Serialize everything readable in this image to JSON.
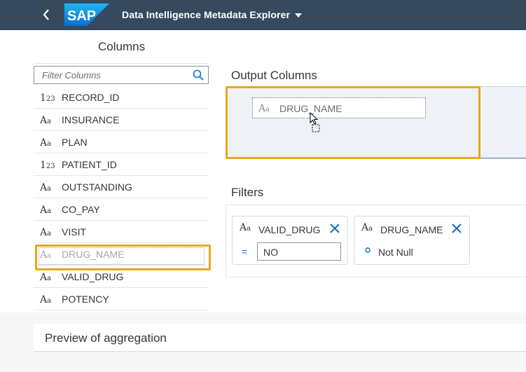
{
  "shell": {
    "app_title": "Data Intelligence Metadata Explorer",
    "logo_text": "SAP",
    "bg_color": "#354a5f"
  },
  "columns_panel": {
    "title": "Columns",
    "filter_placeholder": "Filter Columns",
    "items": [
      {
        "type": "integer",
        "type_glyph_big": "1",
        "type_glyph_small": "23",
        "name": "RECORD_ID"
      },
      {
        "type": "string",
        "type_glyph_big": "A",
        "type_glyph_small": "a",
        "name": "INSURANCE"
      },
      {
        "type": "string",
        "type_glyph_big": "A",
        "type_glyph_small": "a",
        "name": "PLAN"
      },
      {
        "type": "integer",
        "type_glyph_big": "1",
        "type_glyph_small": "23",
        "name": "PATIENT_ID"
      },
      {
        "type": "string",
        "type_glyph_big": "A",
        "type_glyph_small": "a",
        "name": "OUTSTANDING"
      },
      {
        "type": "string",
        "type_glyph_big": "A",
        "type_glyph_small": "a",
        "name": "CO_PAY"
      },
      {
        "type": "string",
        "type_glyph_big": "A",
        "type_glyph_small": "a",
        "name": "VISIT"
      },
      {
        "type": "string",
        "type_glyph_big": "A",
        "type_glyph_small": "a",
        "name": "DRUG_NAME",
        "dragging": true
      },
      {
        "type": "string",
        "type_glyph_big": "A",
        "type_glyph_small": "a",
        "name": "VALID_DRUG"
      },
      {
        "type": "string",
        "type_glyph_big": "A",
        "type_glyph_small": "a",
        "name": "POTENCY"
      }
    ]
  },
  "output_columns": {
    "title": "Output Columns",
    "drag_item": {
      "type_glyph_big": "A",
      "type_glyph_small": "a",
      "name": "DRUG_NAME"
    }
  },
  "filters": {
    "title": "Filters",
    "cards": [
      {
        "type_glyph_big": "A",
        "type_glyph_small": "a",
        "column": "VALID_DRUG",
        "operator": "=",
        "value": "NO"
      },
      {
        "type_glyph_big": "A",
        "type_glyph_small": "a",
        "column": "DRUG_NAME",
        "operator_icon": "circle-icon",
        "condition": "Not Null"
      }
    ]
  },
  "preview": {
    "title": "Preview of aggregation"
  },
  "colors": {
    "highlight": "#e5a91a",
    "accent": "#0a6ed1"
  }
}
